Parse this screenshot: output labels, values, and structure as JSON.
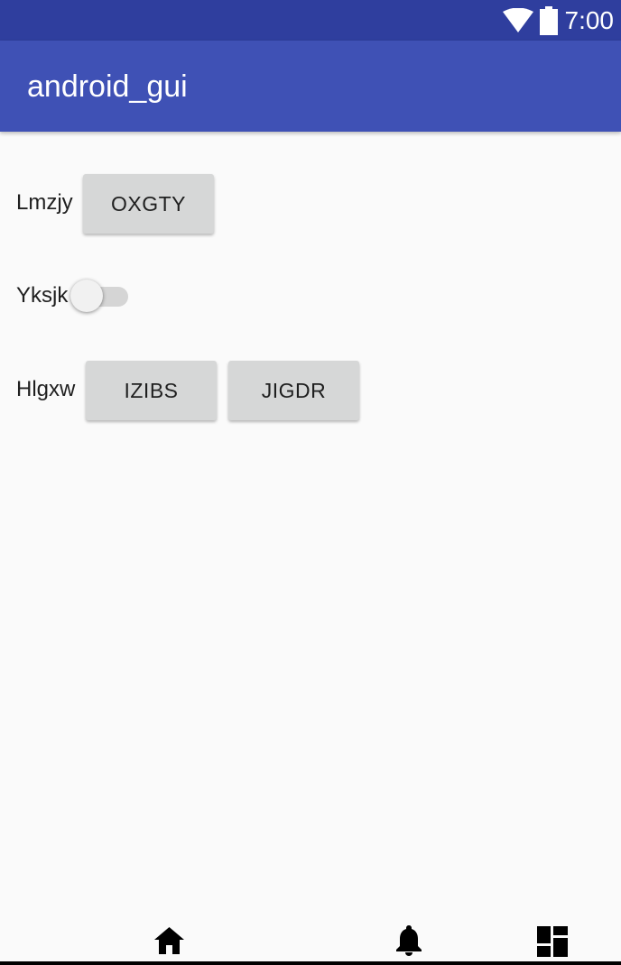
{
  "status_bar": {
    "time": "7:00",
    "icons": [
      "wifi-icon",
      "battery-icon"
    ],
    "background": "#2f3e9e"
  },
  "app_bar": {
    "title": "android_gui",
    "background": "#3f51b5"
  },
  "rows": [
    {
      "label": "Lmzjy",
      "buttons": [
        "OXGTY"
      ]
    },
    {
      "label": "Yksjk",
      "switch_on": false
    },
    {
      "label": "Hlgxw",
      "buttons": [
        "IZIBS",
        "JIGDR"
      ]
    }
  ],
  "bottom_nav": {
    "icons": [
      "home-icon",
      "bell-icon",
      "dashboard-icon"
    ]
  }
}
